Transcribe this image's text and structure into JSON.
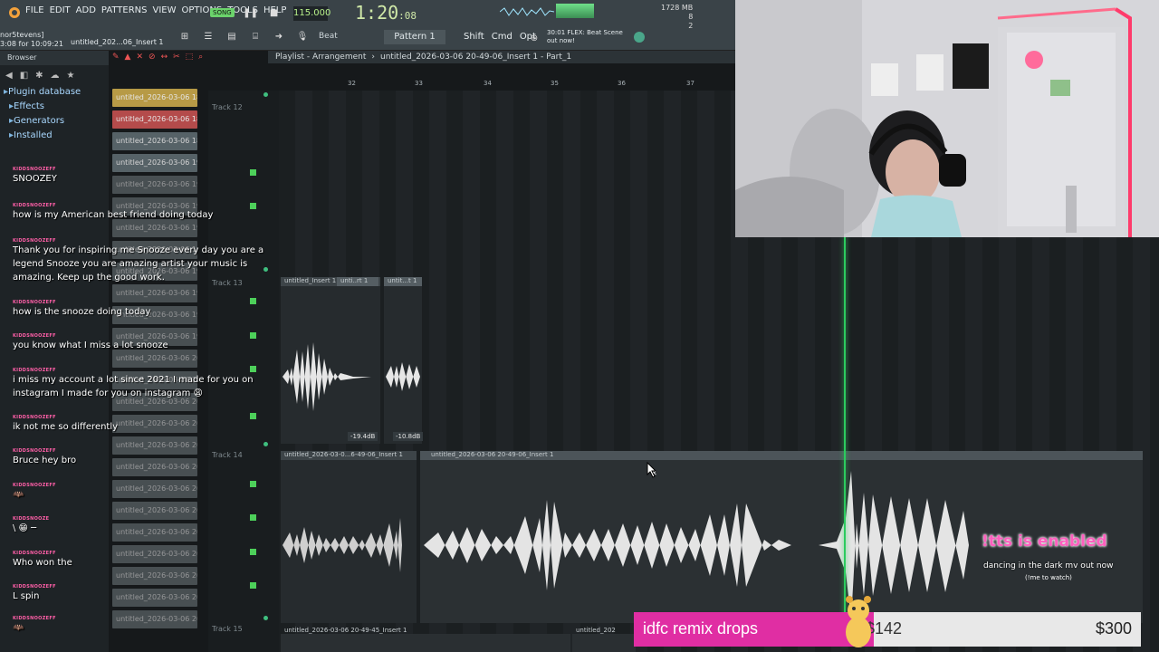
{
  "menu": [
    "FILE",
    "EDIT",
    "ADD",
    "PATTERNS",
    "VIEW",
    "OPTIONS",
    "TOOLS",
    "HELP"
  ],
  "hint": {
    "line1": "nor5tevens]",
    "line2": "3:08 for 10:09:21"
  },
  "song_badge": "SONG",
  "tempo": "115.000",
  "clock": {
    "main": "1:20",
    "sub": ":08"
  },
  "cpu": {
    "mem": "1728 MB",
    "val1": "8",
    "val2": "2"
  },
  "subbar": {
    "snap": "Beat",
    "short_title": "untitled_202...06_Insert 1"
  },
  "pattern": "Pattern 1",
  "keys": [
    "Shift",
    "Cmd",
    "Opt"
  ],
  "news": {
    "line1": "30:01  FLEX: Beat Scene",
    "line2": "out now!"
  },
  "browser": {
    "title": "Browser",
    "items": [
      "Plugin database",
      "Effects",
      "Generators",
      "Installed"
    ]
  },
  "clips": [
    "untitled_2026-03-06 18-",
    "untitled_2026-03-06 18-",
    "untitled_2026-03-06 18-",
    "untitled_2026-03-06 19-",
    "untitled_2026-03-06 19-",
    "untitled_2026-03-06 19-",
    "untitled_2026-03-06 19-",
    "untitled_2026-03-06 19-",
    "untitled_2026-03-06 19-",
    "untitled_2026-03-06 19-",
    "untitled_2026-03-06 19-",
    "untitled_2026-03-06 19-",
    "untitled_2026-03-06 20-",
    "untitled_2026-03-06 20-",
    "untitled_2026-03-06 20-",
    "untitled_2026-03-06 20-",
    "untitled_2026-03-06 20-",
    "untitled_2026-03-06 20-",
    "untitled_2026-03-06 20-",
    "untitled_2026-03-06 20-",
    "untitled_2026-03-06 20-",
    "untitled_2026-03-06 20-",
    "untitled_2026-03-06 20-",
    "untitled_2026-03-06 20-",
    "untitled_2026-03-06 20-"
  ],
  "playlist": {
    "title": "Playlist - Arrangement",
    "path": "untitled_2026-03-06 20-49-06_Insert 1 - Part_1"
  },
  "ruler": [
    "32",
    "33",
    "34",
    "35",
    "36",
    "37"
  ],
  "tracks": {
    "t12": "Track 12",
    "t13": "Track 13",
    "t14": "Track 14",
    "t15": "Track 15"
  },
  "audio": {
    "a1": "untitled_Insert 1",
    "a2": "unti..rt 1",
    "a3": "untit...t 1",
    "a4": "untitled_2026-03-0...6-49-06_Insert 1",
    "a5": "untitled_2026-03-06 20-49-06_Insert 1",
    "a6": "untitled_2026-03-06 20-49-45_Insert 1",
    "a7": "untitled_202",
    "db1": "-19.4dB",
    "db2": "-10.8dB"
  },
  "chat": [
    {
      "user": "KIDDSNOOZEFF",
      "text": "SNOOZEY"
    },
    {
      "user": "KIDDSNOOZEFF",
      "text": "how is my American best friend doing today"
    },
    {
      "user": "KIDDSNOOZEFF",
      "text": "Thank you for inspiring me Snooze every day you are a legend Snooze you are amazing artist your music is amazing. Keep up the good work."
    },
    {
      "user": "KIDDSNOOZEFF",
      "text": "how is the snooze doing today"
    },
    {
      "user": "KIDDSNOOZEFF",
      "text": "you know what I miss a lot snooze"
    },
    {
      "user": "KIDDSNOOZEFF",
      "text": "i miss my account a lot since 2021 I made for you on instagram I made for you on instagram 😩"
    },
    {
      "user": "KIDDSNOOZEFF",
      "text": "ik not me so differently"
    },
    {
      "user": "KIDDSNOOZEFF",
      "text": "Bruce hey bro"
    },
    {
      "user": "KIDDSNOOZEFF",
      "text": "🦇"
    },
    {
      "user": "KIDDSNOOZE",
      "text": "\\ 😁 ─"
    },
    {
      "user": "KIDDSNOOZEFF",
      "text": "Who won the"
    },
    {
      "user": "KIDDSNOOZEFF",
      "text": "L spin"
    },
    {
      "user": "KIDDSNOOZEFF",
      "text": "🦇"
    }
  ],
  "overlay": {
    "tts": "!tts is enabled",
    "promo": "dancing in the dark mv out now",
    "promo_sub": "(!me to watch)"
  },
  "goal": {
    "title": "idfc remix drops",
    "current": "$142",
    "target": "$300",
    "progress": 0.4733
  },
  "colors": {
    "accent_green": "#2ccb5e",
    "chat_user": "#ff5fa8",
    "goal_pink": "#e02ea3"
  }
}
